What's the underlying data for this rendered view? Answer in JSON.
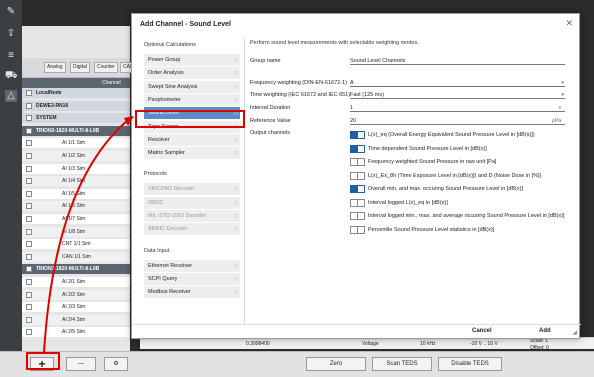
{
  "rail": {
    "icons": [
      {
        "name": "edit-icon",
        "glyph": "✎"
      },
      {
        "name": "share-icon",
        "glyph": "⇪"
      },
      {
        "name": "list-icon",
        "glyph": "≡"
      },
      {
        "name": "vehicle-icon",
        "glyph": "⛟"
      },
      {
        "name": "alert-icon",
        "glyph": "△"
      }
    ]
  },
  "tree": {
    "toolbar": [
      "Analog",
      "Digital",
      "Counter",
      "CAN"
    ],
    "column_header": "Channel",
    "rows": [
      {
        "kind": "grp",
        "text": "LocalNode"
      },
      {
        "kind": "grp",
        "text": "DEWE3-RN16"
      },
      {
        "kind": "grp",
        "text": "SYSTEM"
      },
      {
        "kind": "trion",
        "text": "TRION3-1820-MULTI-8-L0B"
      },
      {
        "kind": "ch",
        "text": "AI 1/1 Sim"
      },
      {
        "kind": "ch2",
        "text": "AI 1/2 Sim"
      },
      {
        "kind": "ch",
        "text": "AI 1/3 Sim"
      },
      {
        "kind": "ch2",
        "text": "AI 1/4 Sim"
      },
      {
        "kind": "ch",
        "text": "AI 1/5 Sim"
      },
      {
        "kind": "ch2",
        "text": "AI 1/6 Sim"
      },
      {
        "kind": "ch",
        "text": "AI 1/7 Sim"
      },
      {
        "kind": "ch2",
        "text": "AI 1/8 Sim"
      },
      {
        "kind": "ch",
        "text": "CNT 1/1 Sim"
      },
      {
        "kind": "ch2",
        "text": "CAN 1/1 Sim"
      },
      {
        "kind": "trion",
        "text": "TRION3-1820-MULTI-8-L0B"
      },
      {
        "kind": "ch",
        "text": "AI 2/1 Sim"
      },
      {
        "kind": "ch2",
        "text": "AI 2/2 Sim"
      },
      {
        "kind": "ch",
        "text": "AI 2/3 Sim"
      },
      {
        "kind": "ch2",
        "text": "AI 2/4 Sim"
      },
      {
        "kind": "ch",
        "text": "AI 2/5 Sim"
      }
    ]
  },
  "status": {
    "value": "0.3998400",
    "type": "Voltage",
    "rate": "10 kHz",
    "range": "-10 V .. 10 V",
    "scale": "Scale: 1",
    "offset": "Offset: 0"
  },
  "bottom": {
    "add_glyph": "+",
    "remove_glyph": "—",
    "settings_glyph": "⚙",
    "zero": "Zero",
    "scan_teds": "Scan TEDS",
    "disable_teds": "Disable TEDS"
  },
  "dialog": {
    "title": "Add Channel - Sound Level",
    "close": "✕",
    "sections": [
      {
        "title": "Optional Calculations",
        "items": [
          {
            "label": "Power Group",
            "state": "normal"
          },
          {
            "label": "Order Analysis",
            "state": "normal"
          },
          {
            "label": "Swept Sine Analysis",
            "state": "normal"
          },
          {
            "label": "Psophometer",
            "state": "normal"
          },
          {
            "label": "Sound Level",
            "state": "selected"
          },
          {
            "label": "Tape Sensor",
            "state": "normal"
          },
          {
            "label": "Resolver",
            "state": "normal"
          },
          {
            "label": "Matrix Sampler",
            "state": "normal"
          }
        ]
      },
      {
        "title": "Protocols",
        "items": [
          {
            "label": "XR/CPAD Decoder",
            "state": "disabled"
          },
          {
            "label": "OBD2",
            "state": "disabled"
          },
          {
            "label": "MIL-STD-1553 Decoder",
            "state": "disabled"
          },
          {
            "label": "ARINC Decoder",
            "state": "disabled"
          }
        ]
      },
      {
        "title": "Data Input",
        "items": [
          {
            "label": "Ethernet Receiver",
            "state": "normal"
          },
          {
            "label": "SCPI Query",
            "state": "normal"
          },
          {
            "label": "Modbus Receiver",
            "state": "normal"
          }
        ]
      }
    ],
    "description": "Perform sound level measurements with selectable weighting modes.",
    "fields": {
      "group_name": {
        "label": "Group name",
        "value": "Sound Level Channels"
      },
      "freq_weighting": {
        "label": "Frequency weighting (DIN-EN-61672-1)",
        "value": "A"
      },
      "time_weighting": {
        "label": "Time weighting (IEC 61672 and IEC 651)",
        "value": "Fast (125 ms)"
      },
      "interval_duration": {
        "label": "Interval Duration",
        "value": "1",
        "unit": "s"
      },
      "reference_value": {
        "label": "Reference Value",
        "value": "20",
        "unit": "µPa"
      }
    },
    "output_label": "Output channels",
    "outputs": [
      {
        "label": "L(x)_eq (Overall Energy Equivalent Sound Pressure Level in [dB(x)])",
        "on": true
      },
      {
        "label": "Time dependent Sound Pressure Level in [dB(x)]",
        "on": true
      },
      {
        "label": "Frequency weighted Sound Pressure in raw unit [Pa]",
        "on": false
      },
      {
        "label": "L(x)_Ex_8h (Time Exposure Level in [dB(x)]) and D (Noise Dose in [%])",
        "on": false
      },
      {
        "label": "Overall min. and max. occuring Sound Pressure Level in [dB(x)]",
        "on": true
      },
      {
        "label": "Interval logged L(x)_eq in [dB(x)]",
        "on": false
      },
      {
        "label": "Interval logged min., max. and average occuring Sound Pressure Level in [dB(x)]",
        "on": false
      },
      {
        "label": "Percentile Sound Pressure Level statistics in [dB(x)]",
        "on": false
      }
    ],
    "cancel": "Cancel",
    "add": "Add"
  },
  "colors": {
    "highlight": "#e00000",
    "selected": "#5a8ec4",
    "toggle_on": "#1f5fa6"
  }
}
